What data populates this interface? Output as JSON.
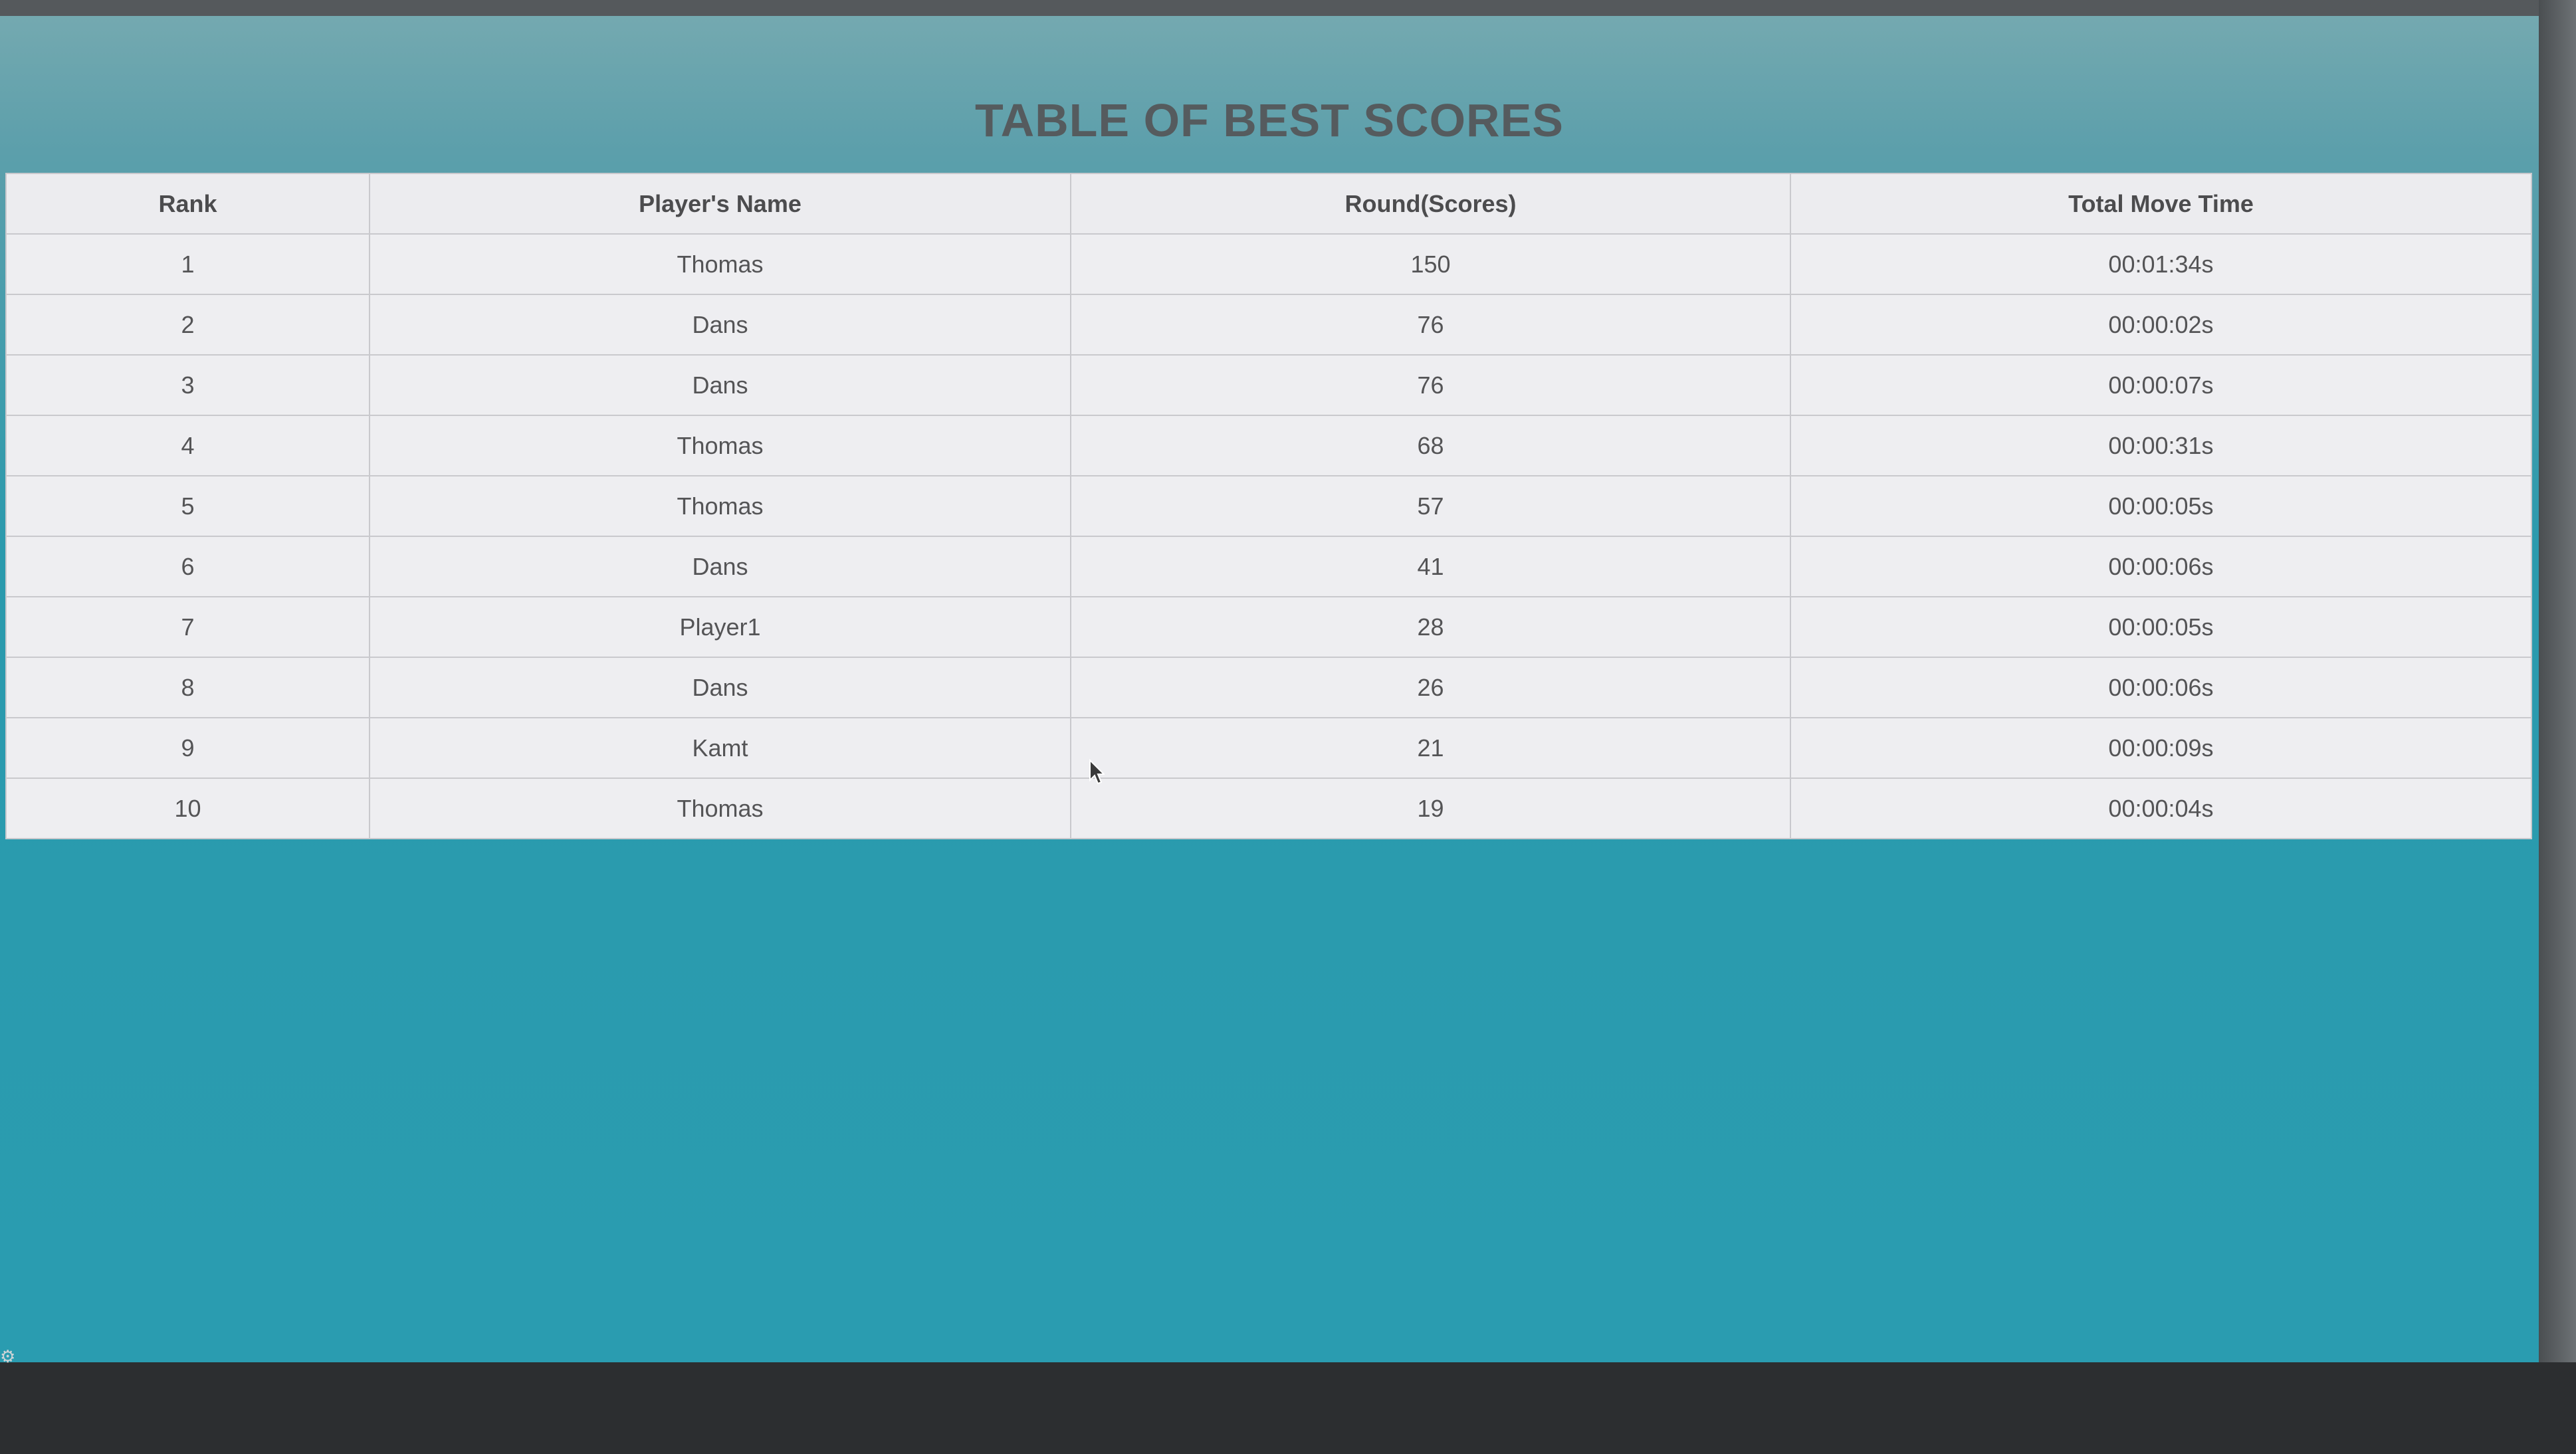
{
  "page": {
    "title": "TABLE OF BEST SCORES"
  },
  "table": {
    "headers": {
      "rank": "Rank",
      "name": "Player's Name",
      "score": "Round(Scores)",
      "time": "Total Move Time"
    },
    "rows": [
      {
        "rank": "1",
        "name": "Thomas",
        "score": "150",
        "time": "00:01:34s"
      },
      {
        "rank": "2",
        "name": "Dans",
        "score": "76",
        "time": "00:00:02s"
      },
      {
        "rank": "3",
        "name": "Dans",
        "score": "76",
        "time": "00:00:07s"
      },
      {
        "rank": "4",
        "name": "Thomas",
        "score": "68",
        "time": "00:00:31s"
      },
      {
        "rank": "5",
        "name": "Thomas",
        "score": "57",
        "time": "00:00:05s"
      },
      {
        "rank": "6",
        "name": "Dans",
        "score": "41",
        "time": "00:00:06s"
      },
      {
        "rank": "7",
        "name": "Player1",
        "score": "28",
        "time": "00:00:05s"
      },
      {
        "rank": "8",
        "name": "Dans",
        "score": "26",
        "time": "00:00:06s"
      },
      {
        "rank": "9",
        "name": "Kamt",
        "score": "21",
        "time": "00:00:09s"
      },
      {
        "rank": "10",
        "name": "Thomas",
        "score": "19",
        "time": "00:00:04s"
      }
    ]
  },
  "icons": {
    "settings": "gear-icon",
    "cursor": "mouse-pointer-icon"
  },
  "colors": {
    "background_teal": "#2a9cb0",
    "table_background": "#ebebee",
    "title_text": "#555b5e"
  }
}
